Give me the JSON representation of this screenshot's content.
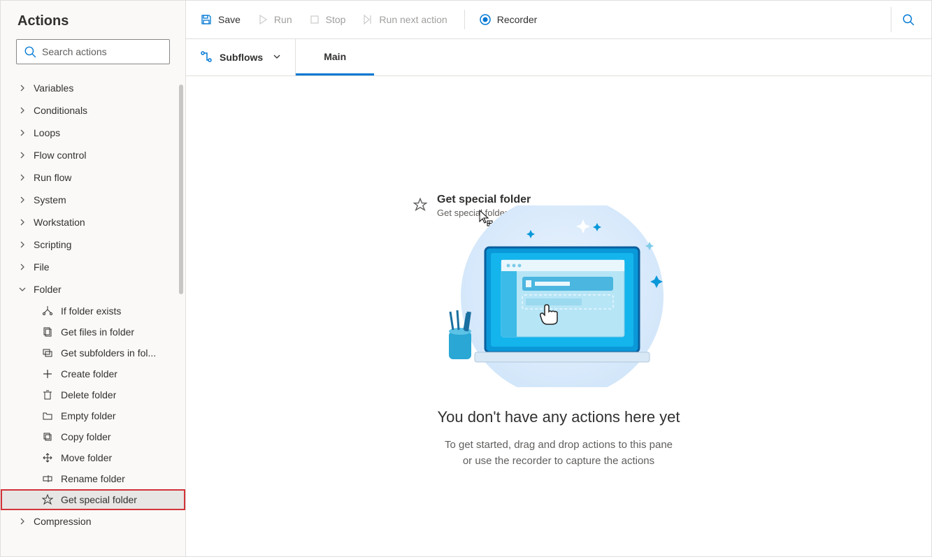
{
  "sidebar": {
    "title": "Actions",
    "search_placeholder": "Search actions",
    "groups": [
      {
        "label": "Variables",
        "expanded": false
      },
      {
        "label": "Conditionals",
        "expanded": false
      },
      {
        "label": "Loops",
        "expanded": false
      },
      {
        "label": "Flow control",
        "expanded": false
      },
      {
        "label": "Run flow",
        "expanded": false
      },
      {
        "label": "System",
        "expanded": false
      },
      {
        "label": "Workstation",
        "expanded": false
      },
      {
        "label": "Scripting",
        "expanded": false
      },
      {
        "label": "File",
        "expanded": false
      },
      {
        "label": "Folder",
        "expanded": true,
        "children": [
          {
            "label": "If folder exists",
            "icon": "branch"
          },
          {
            "label": "Get files in folder",
            "icon": "files"
          },
          {
            "label": "Get subfolders in fol...",
            "icon": "subfolders"
          },
          {
            "label": "Create folder",
            "icon": "plus"
          },
          {
            "label": "Delete folder",
            "icon": "trash"
          },
          {
            "label": "Empty folder",
            "icon": "folder"
          },
          {
            "label": "Copy folder",
            "icon": "copy"
          },
          {
            "label": "Move folder",
            "icon": "move"
          },
          {
            "label": "Rename folder",
            "icon": "rename"
          },
          {
            "label": "Get special folder",
            "icon": "star",
            "selected": true
          }
        ]
      },
      {
        "label": "Compression",
        "expanded": false
      }
    ]
  },
  "toolbar": {
    "save": "Save",
    "run": "Run",
    "stop": "Stop",
    "run_next": "Run next action",
    "recorder": "Recorder"
  },
  "tabbar": {
    "subflows": "Subflows",
    "main_tab": "Main"
  },
  "drag": {
    "title": "Get special folder",
    "subtitle": "Get special folder"
  },
  "empty": {
    "title": "You don't have any actions here yet",
    "line1": "To get started, drag and drop actions to this pane",
    "line2": "or use the recorder to capture the actions"
  }
}
